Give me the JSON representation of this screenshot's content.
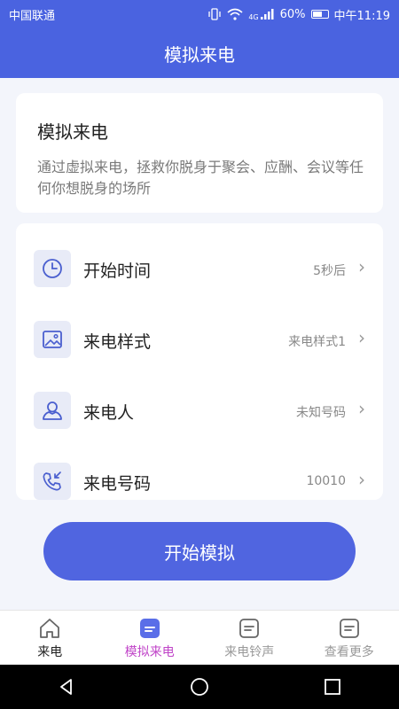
{
  "status_bar": {
    "carrier": "中国联通",
    "network": "4G",
    "battery": "60%",
    "time": "中午11:19"
  },
  "header": {
    "title": "模拟来电"
  },
  "intro": {
    "title": "模拟来电",
    "description": "通过虚拟来电，拯救你脱身于聚会、应酬、会议等任何你想脱身的场所"
  },
  "settings": [
    {
      "label": "开始时间",
      "value": "5秒后",
      "icon": "clock-icon"
    },
    {
      "label": "来电样式",
      "value": "来电样式1",
      "icon": "image-icon"
    },
    {
      "label": "来电人",
      "value": "未知号码",
      "icon": "person-icon"
    },
    {
      "label": "来电号码",
      "value": "10010",
      "icon": "phone-incoming-icon"
    }
  ],
  "start_button": {
    "label": "开始模拟"
  },
  "tabs": [
    {
      "label": "来电",
      "active": false,
      "icon": "home-icon"
    },
    {
      "label": "模拟来电",
      "active": true,
      "icon": "doc-icon"
    },
    {
      "label": "来电铃声",
      "active": false,
      "icon": "doc-icon"
    },
    {
      "label": "查看更多",
      "active": false,
      "icon": "doc-icon"
    }
  ],
  "colors": {
    "primary": "#4a63e0",
    "active_tab": "#c044c8",
    "inactive_tab": "#999999",
    "icon_stroke": "#4a5fcf"
  }
}
